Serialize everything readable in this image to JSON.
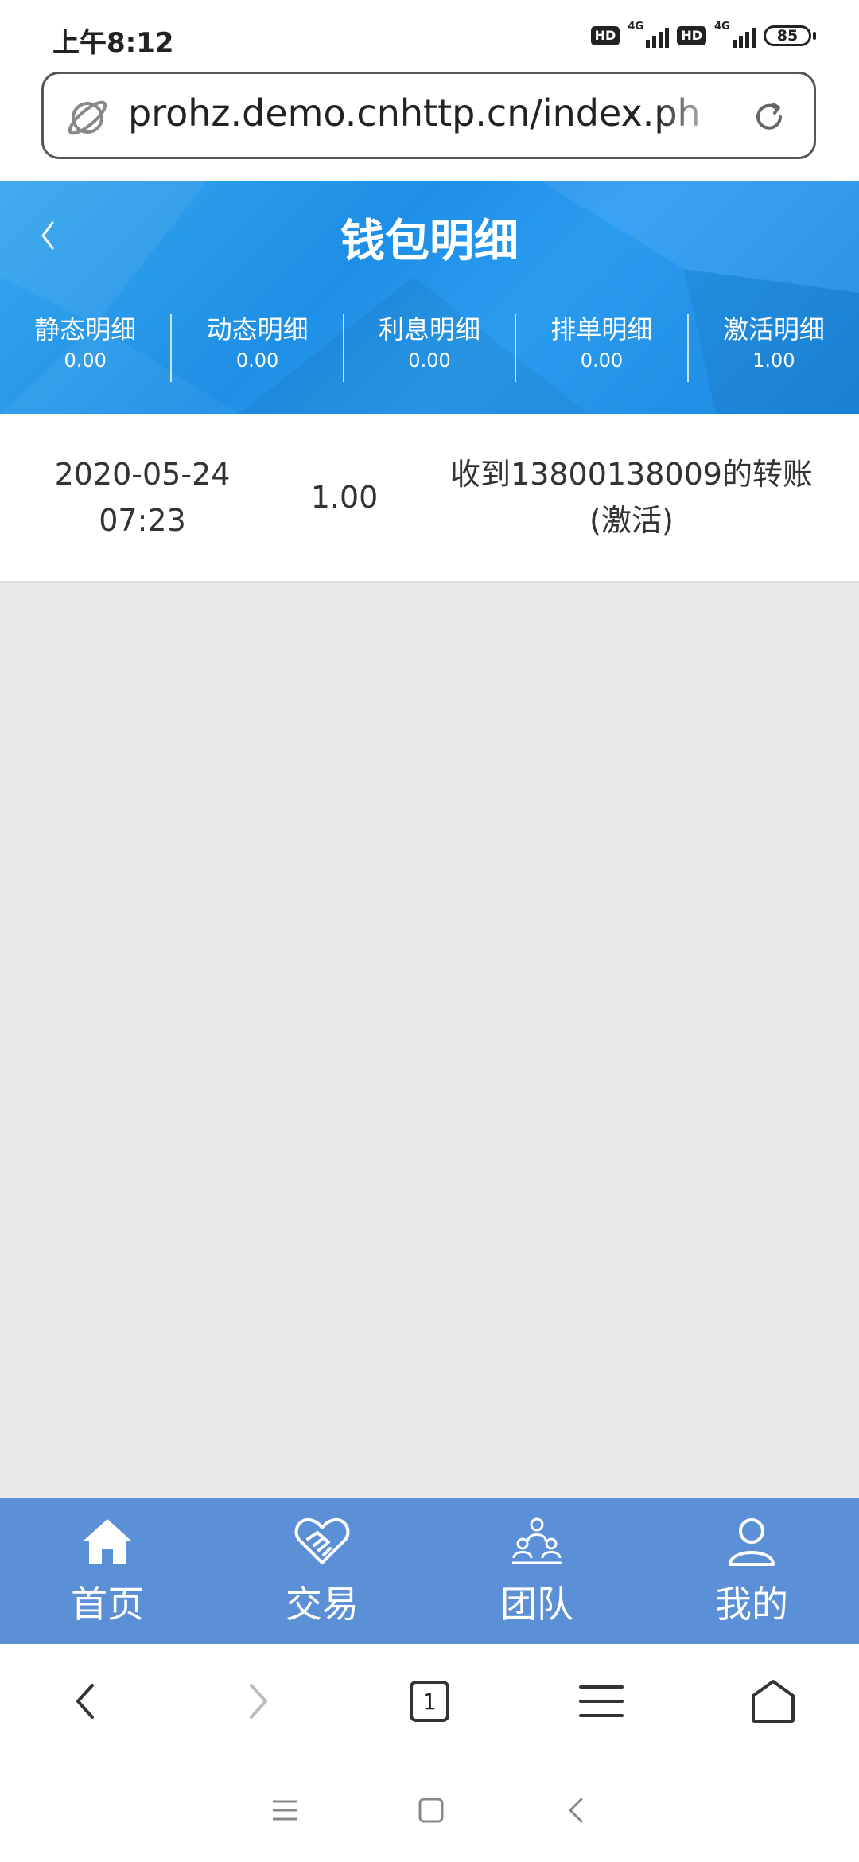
{
  "status_bar": {
    "time": "上午8:12",
    "hd_label": "HD",
    "network_label": "4G",
    "battery": "85"
  },
  "url_bar": {
    "url": "prohz.demo.cnhttp.cn/index.ph"
  },
  "header": {
    "title": "钱包明细",
    "stats": [
      {
        "label": "静态明细",
        "value": "0.00"
      },
      {
        "label": "动态明细",
        "value": "0.00"
      },
      {
        "label": "利息明细",
        "value": "0.00"
      },
      {
        "label": "排单明细",
        "value": "0.00"
      },
      {
        "label": "激活明细",
        "value": "1.00"
      }
    ]
  },
  "records": [
    {
      "date": "2020-05-24",
      "time": "07:23",
      "amount": "1.00",
      "desc_line1": "收到13800138009的转账",
      "desc_line2": "(激活)"
    }
  ],
  "tabbar": {
    "items": [
      {
        "label": "首页",
        "icon": "home-icon"
      },
      {
        "label": "交易",
        "icon": "handshake-icon"
      },
      {
        "label": "团队",
        "icon": "team-icon"
      },
      {
        "label": "我的",
        "icon": "user-icon"
      }
    ]
  },
  "browser_bar": {
    "tab_count": "1"
  },
  "colors": {
    "header_blue": "#1e8fe6",
    "tabbar_blue": "#5b8fd6",
    "background": "#e9e9e9"
  }
}
